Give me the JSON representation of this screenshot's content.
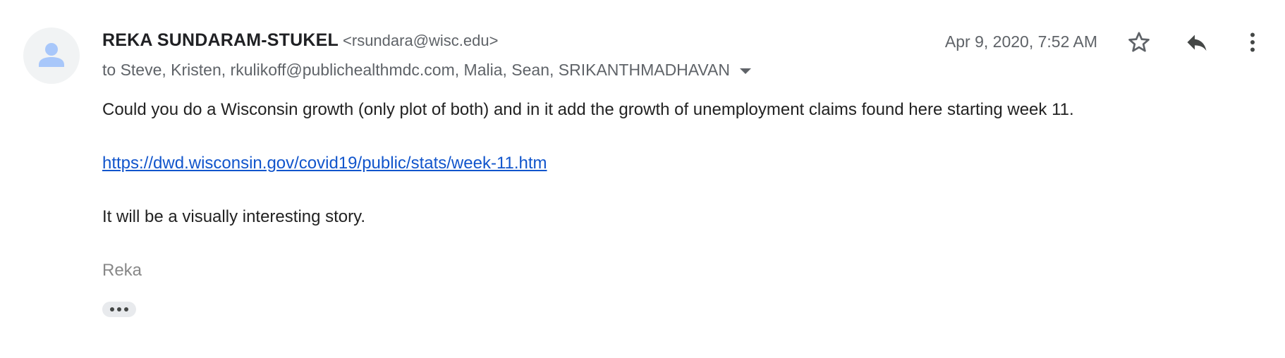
{
  "sender": {
    "name": "REKA SUNDARAM-STUKEL",
    "email": "<rsundara@wisc.edu>"
  },
  "recipients": "to Steve, Kristen, rkulikoff@publichealthmdc.com, Malia, Sean, SRIKANTHMADHAVAN",
  "date": "Apr 9, 2020, 7:52 AM",
  "body": {
    "line1": "Could you do a Wisconsin growth (only plot of both) and in it add the growth of unemployment claims found here starting week 11.",
    "link": "https://dwd.wisconsin.gov/covid19/public/stats/week-11.htm",
    "line3": "It will be a visually interesting story.",
    "signature": "Reka"
  },
  "icons": {
    "avatar": "person-avatar-icon",
    "star": "star-outline-icon",
    "reply": "reply-icon",
    "more": "more-vert-icon",
    "recipients_toggle": "caret-down-icon",
    "trimmed": "ellipsis-icon"
  },
  "colors": {
    "link": "#1155cc",
    "avatar_bg": "#f1f3f4",
    "avatar_fg": "#a8c7fa",
    "meta_text": "#5f6368",
    "signature": "#888888"
  }
}
